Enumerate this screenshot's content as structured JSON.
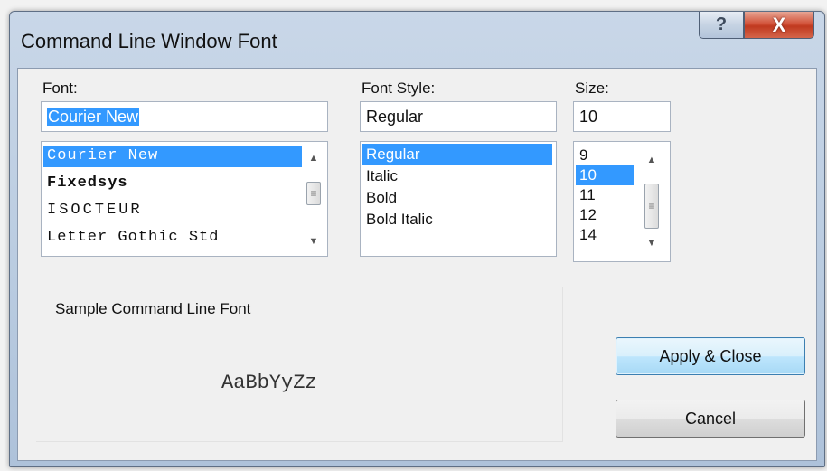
{
  "window": {
    "title": "Command Line Window Font",
    "help_label": "?",
    "close_label": "X"
  },
  "font": {
    "label": "Font:",
    "value": "Courier New",
    "items": [
      {
        "label": "Courier New",
        "selected": true
      },
      {
        "label": "Fixedsys",
        "selected": false
      },
      {
        "label": "ISOCTEUR",
        "selected": false
      },
      {
        "label": "Letter Gothic Std",
        "selected": false
      }
    ]
  },
  "font_style": {
    "label": "Font Style:",
    "value": "Regular",
    "items": [
      {
        "label": "Regular",
        "selected": true
      },
      {
        "label": "Italic",
        "selected": false
      },
      {
        "label": "Bold",
        "selected": false
      },
      {
        "label": "Bold Italic",
        "selected": false
      }
    ]
  },
  "size": {
    "label": "Size:",
    "value": "10",
    "items": [
      {
        "label": "9",
        "selected": false
      },
      {
        "label": "10",
        "selected": true
      },
      {
        "label": "11",
        "selected": false
      },
      {
        "label": "12",
        "selected": false
      },
      {
        "label": "14",
        "selected": false
      }
    ]
  },
  "sample": {
    "label": "Sample Command Line Font",
    "text": "AaBbYyZz"
  },
  "buttons": {
    "apply": "Apply & Close",
    "cancel": "Cancel"
  },
  "colors": {
    "selection": "#3399ff",
    "close_button": "#c7412a"
  }
}
